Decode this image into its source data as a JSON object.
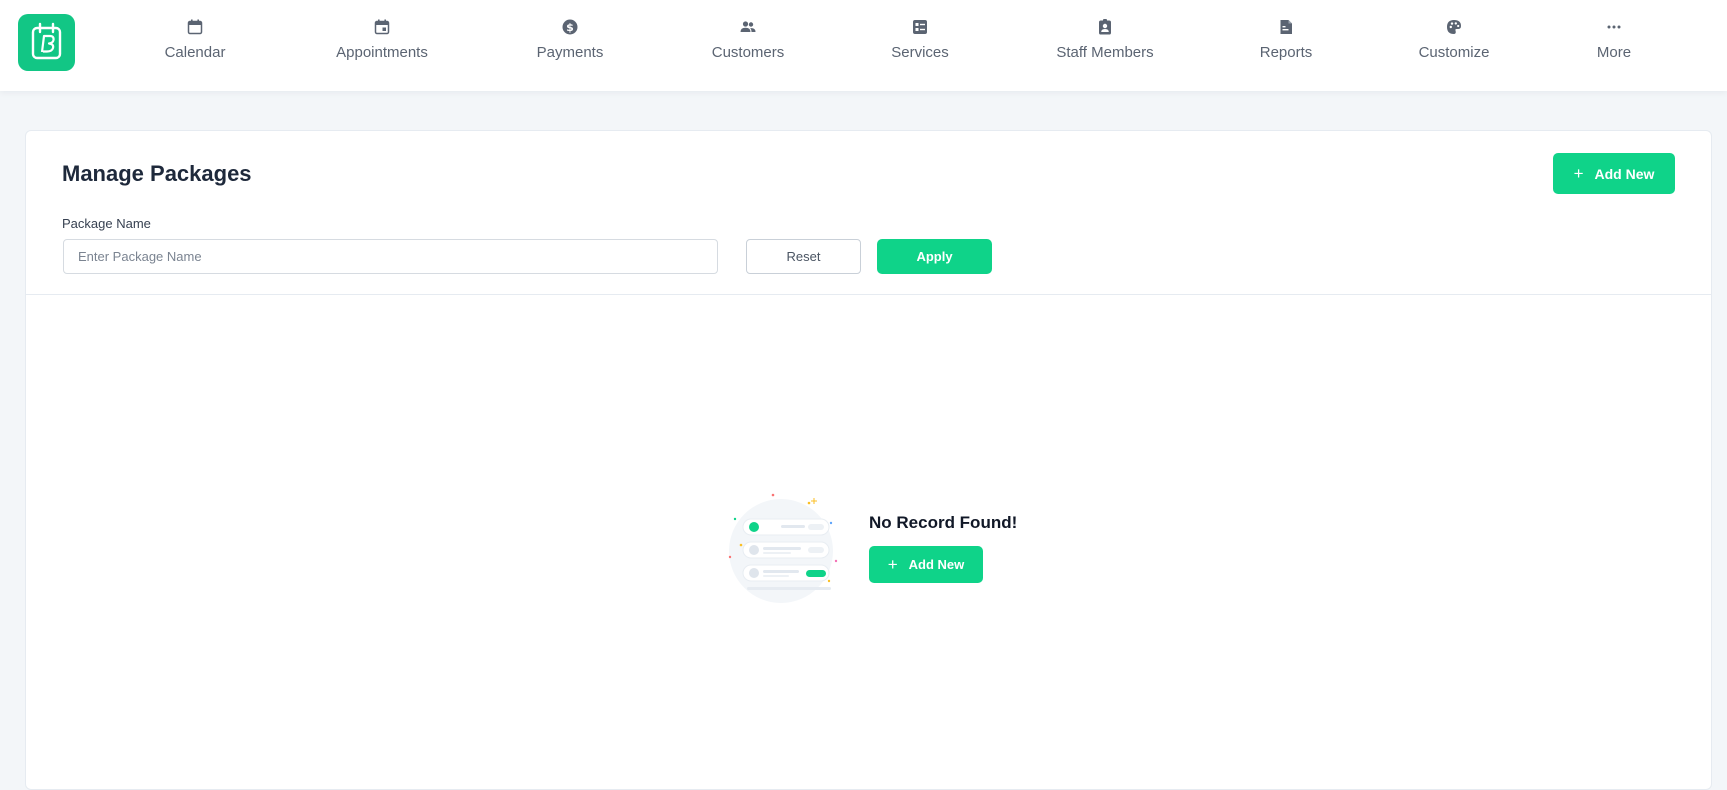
{
  "app": {
    "logo_icon": "booking-calendar-logo-icon",
    "accent_color": "#0fd389"
  },
  "nav": {
    "items": [
      {
        "label": "Calendar",
        "icon": "calendar-icon"
      },
      {
        "label": "Appointments",
        "icon": "calendar-event-icon"
      },
      {
        "label": "Payments",
        "icon": "dollar-circle-icon"
      },
      {
        "label": "Customers",
        "icon": "users-icon"
      },
      {
        "label": "Services",
        "icon": "service-list-icon"
      },
      {
        "label": "Staff Members",
        "icon": "staff-badge-icon"
      },
      {
        "label": "Reports",
        "icon": "report-document-icon"
      },
      {
        "label": "Customize",
        "icon": "palette-icon"
      },
      {
        "label": "More",
        "icon": "more-dots-icon"
      }
    ]
  },
  "main": {
    "title": "Manage Packages",
    "add_new_label": "Add New",
    "filter": {
      "label": "Package Name",
      "value": "",
      "placeholder": "Enter Package Name",
      "reset_label": "Reset",
      "apply_label": "Apply"
    },
    "empty_state": {
      "illustration": "empty-list-illustration",
      "message": "No Record Found!",
      "add_new_label": "Add New"
    }
  }
}
